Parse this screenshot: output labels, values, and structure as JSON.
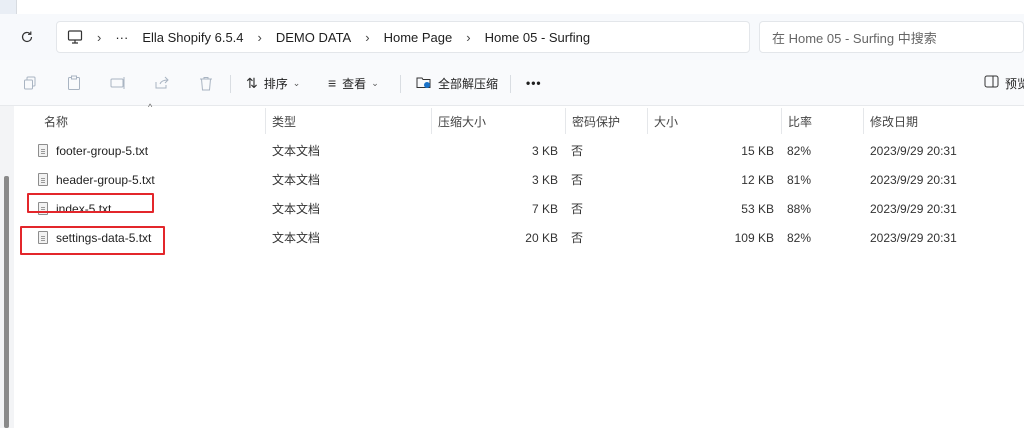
{
  "breadcrumb": [
    "Ella Shopify 6.5.4",
    "DEMO DATA",
    "Home Page",
    "Home 05 - Surfing"
  ],
  "search": {
    "placeholder": "在 Home 05 - Surfing 中搜索"
  },
  "toolbar": {
    "sort_label": "排序",
    "view_label": "查看",
    "extract_all_label": "全部解压缩",
    "more_label": "•••",
    "preview_label": "预览"
  },
  "columns": {
    "name": "名称",
    "type": "类型",
    "packed": "压缩大小",
    "protected": "密码保护",
    "size": "大小",
    "ratio": "比率",
    "modified": "修改日期"
  },
  "files": [
    {
      "name": "footer-group-5.txt",
      "type": "文本文档",
      "packed": "3 KB",
      "protected": "否",
      "size": "15 KB",
      "ratio": "82%",
      "modified": "2023/9/29 20:31"
    },
    {
      "name": "header-group-5.txt",
      "type": "文本文档",
      "packed": "3 KB",
      "protected": "否",
      "size": "12 KB",
      "ratio": "81%",
      "modified": "2023/9/29 20:31"
    },
    {
      "name": "index-5.txt",
      "type": "文本文档",
      "packed": "7 KB",
      "protected": "否",
      "size": "53 KB",
      "ratio": "88%",
      "modified": "2023/9/29 20:31"
    },
    {
      "name": "settings-data-5.txt",
      "type": "文本文档",
      "packed": "20 KB",
      "protected": "否",
      "size": "109 KB",
      "ratio": "82%",
      "modified": "2023/9/29 20:31"
    }
  ],
  "colors": {
    "highlight": "#e3262b",
    "nav_bg": "#f7f9fc"
  }
}
